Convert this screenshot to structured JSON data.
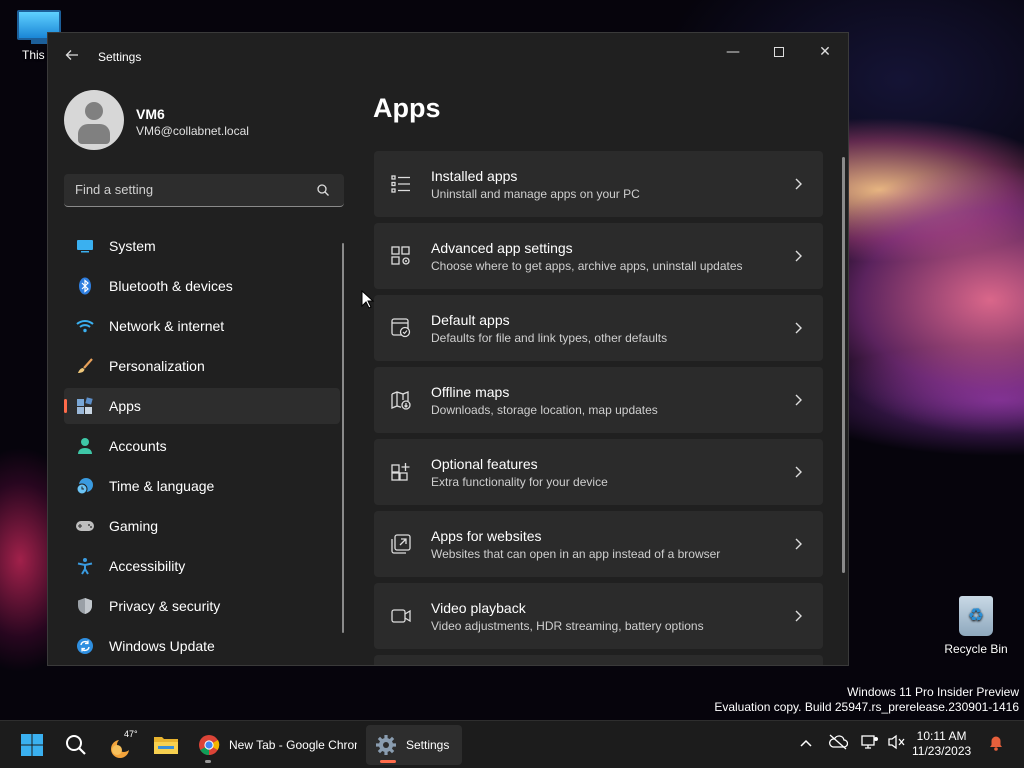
{
  "desktop": {
    "icons": {
      "this_pc": "This P",
      "recycle_bin": "Recycle Bin"
    },
    "watermark": {
      "line1": "Windows 11 Pro Insider Preview",
      "line2": "Evaluation copy. Build 25947.rs_prerelease.230901-1416"
    }
  },
  "window": {
    "title": "Settings",
    "controls": {
      "minimize": "—",
      "close": "✕"
    }
  },
  "profile": {
    "name": "VM6",
    "email": "VM6@collabnet.local"
  },
  "search": {
    "placeholder": "Find a setting"
  },
  "nav": {
    "items": [
      {
        "label": "System",
        "icon": "system-icon"
      },
      {
        "label": "Bluetooth & devices",
        "icon": "bluetooth-icon"
      },
      {
        "label": "Network & internet",
        "icon": "wifi-icon"
      },
      {
        "label": "Personalization",
        "icon": "brush-icon"
      },
      {
        "label": "Apps",
        "icon": "apps-icon",
        "active": true
      },
      {
        "label": "Accounts",
        "icon": "accounts-icon"
      },
      {
        "label": "Time & language",
        "icon": "clock-globe-icon"
      },
      {
        "label": "Gaming",
        "icon": "gamepad-icon"
      },
      {
        "label": "Accessibility",
        "icon": "accessibility-icon"
      },
      {
        "label": "Privacy & security",
        "icon": "shield-icon"
      },
      {
        "label": "Windows Update",
        "icon": "update-icon"
      }
    ]
  },
  "page": {
    "title": "Apps",
    "cards": [
      {
        "title": "Installed apps",
        "subtitle": "Uninstall and manage apps on your PC",
        "icon": "list-icon"
      },
      {
        "title": "Advanced app settings",
        "subtitle": "Choose where to get apps, archive apps, uninstall updates",
        "icon": "app-settings-icon"
      },
      {
        "title": "Default apps",
        "subtitle": "Defaults for file and link types, other defaults",
        "icon": "default-apps-icon"
      },
      {
        "title": "Offline maps",
        "subtitle": "Downloads, storage location, map updates",
        "icon": "map-icon"
      },
      {
        "title": "Optional features",
        "subtitle": "Extra functionality for your device",
        "icon": "optional-features-icon"
      },
      {
        "title": "Apps for websites",
        "subtitle": "Websites that can open in an app instead of a browser",
        "icon": "open-in-app-icon"
      },
      {
        "title": "Video playback",
        "subtitle": "Video adjustments, HDR streaming, battery options",
        "icon": "video-icon"
      }
    ]
  },
  "taskbar": {
    "weather_temp": "47°",
    "chrome_label": "New Tab - Google Chrome",
    "settings_label": "Settings",
    "clock": {
      "time": "10:11 AM",
      "date": "11/23/2023"
    }
  },
  "colors": {
    "accent": "#ff6b4a",
    "window_bg": "#202020",
    "card_bg": "#2b2b2b"
  }
}
